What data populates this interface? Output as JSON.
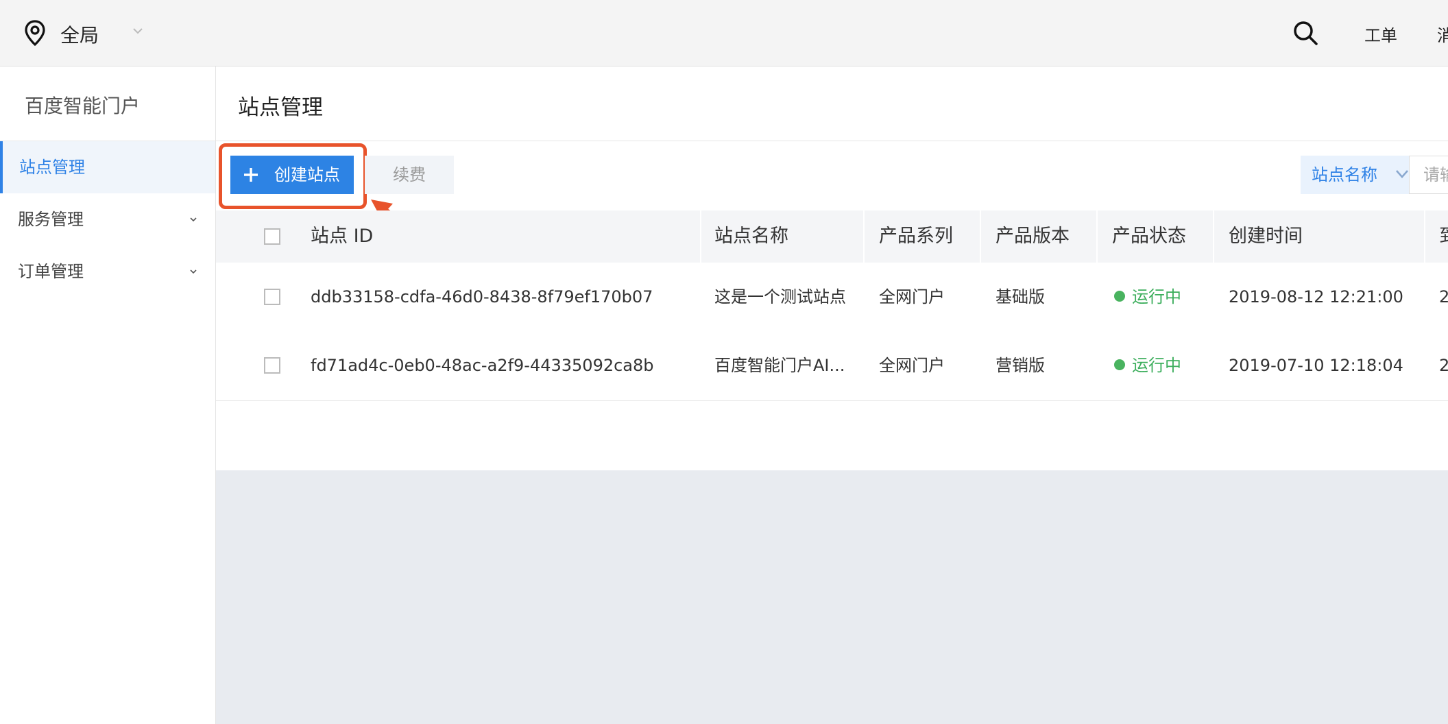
{
  "topbar": {
    "region": "全局",
    "nav": [
      "工单",
      "消"
    ]
  },
  "sidebar": {
    "title": "百度智能门户",
    "items": [
      {
        "label": "站点管理",
        "active": true
      },
      {
        "label": "服务管理"
      },
      {
        "label": "订单管理"
      }
    ]
  },
  "main": {
    "title": "站点管理",
    "toolbar": {
      "create_label": "创建站点",
      "renew_label": "续费",
      "filter_field": "站点名称",
      "search_placeholder": "请输"
    },
    "table": {
      "columns": [
        "站点 ID",
        "站点名称",
        "产品系列",
        "产品版本",
        "产品状态",
        "创建时间",
        "到"
      ],
      "rows": [
        {
          "id": "ddb33158-cdfa-46d0-8438-8f79ef170b07",
          "name": "这是一个测试站点",
          "series": "全网门户",
          "version": "基础版",
          "status": "运行中",
          "created": "2019-08-12 12:21:00",
          "expiry": "2"
        },
        {
          "id": "fd71ad4c-0eb0-48ac-a2f9-44335092ca8b",
          "name": "百度智能门户AI...",
          "series": "全网门户",
          "version": "营销版",
          "status": "运行中",
          "created": "2019-07-10 12:18:04",
          "expiry": "2"
        }
      ]
    }
  },
  "colors": {
    "accent": "#2d83e4",
    "highlight": "#e8532b",
    "status_running": "#49b35f"
  }
}
